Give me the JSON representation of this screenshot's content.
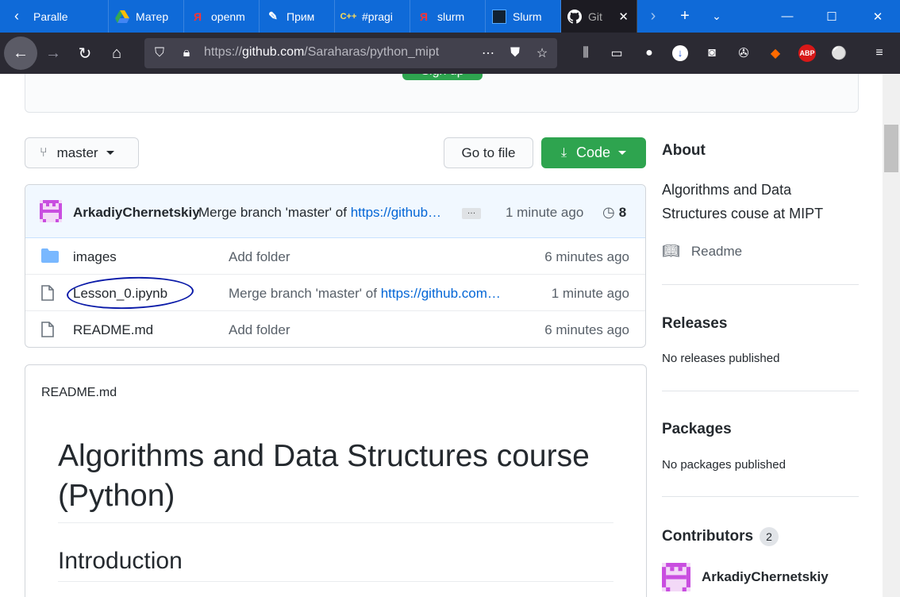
{
  "browser": {
    "tabs": [
      {
        "label": "Paralle",
        "icon": "back-arrow-icon"
      },
      {
        "label": "Матер",
        "icon": "google-drive-icon"
      },
      {
        "label": "openm",
        "icon": "yandex-icon"
      },
      {
        "label": "Прим",
        "icon": "app-icon"
      },
      {
        "label": "#pragi",
        "icon": "cpp-icon"
      },
      {
        "label": "slurm",
        "icon": "yandex-icon"
      },
      {
        "label": "Slurm",
        "icon": "site-icon"
      },
      {
        "label": "Git",
        "icon": "github-icon",
        "active": true
      }
    ],
    "url_prefix": "https://",
    "url_domain": "github.com",
    "url_path": "/Saraharas/python_mipt"
  },
  "hero": {
    "signup_label": "Sign up"
  },
  "repo": {
    "branch_label": "master",
    "goto_label": "Go to file",
    "code_label": "Code",
    "commit": {
      "author": "ArkadiyChernetskiy",
      "message": "Merge branch 'master' of ",
      "link": "https://github…",
      "ellipsis": "…",
      "time": "1 minute ago",
      "history_count": "8"
    },
    "files": [
      {
        "type": "folder",
        "name": "images",
        "message": "Add folder",
        "link": "",
        "time": "6 minutes ago"
      },
      {
        "type": "file",
        "name": "Lesson_0.ipynb",
        "message": "Merge branch 'master' of ",
        "link": "https://github.com…",
        "time": "1 minute ago",
        "annotated": true
      },
      {
        "type": "file",
        "name": "README.md",
        "message": "Add folder",
        "link": "",
        "time": "6 minutes ago"
      }
    ]
  },
  "readme": {
    "filename": "README.md",
    "h1": "Algorithms and Data Structures course (Python)",
    "h2": "Introduction"
  },
  "sidebar": {
    "about_title": "About",
    "about_desc": "Algorithms and Data Structures couse at MIPT",
    "readme_link": "Readme",
    "releases_title": "Releases",
    "releases_text": "No releases published",
    "packages_title": "Packages",
    "packages_text": "No packages published",
    "contributors_title": "Contributors",
    "contributors_count": "2",
    "contributor_name": "ArkadiyChernetskiy"
  },
  "colors": {
    "tabbar": "#0f6ad8",
    "toolbar": "#2b2a33",
    "primary_button": "#2ea44f",
    "link": "#0366d6",
    "annotation": "#0a1aa8"
  }
}
